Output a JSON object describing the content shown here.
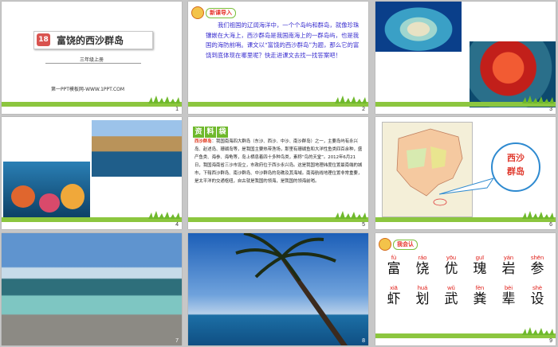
{
  "slide_numbers": [
    "1",
    "2",
    "3",
    "4",
    "5",
    "6",
    "7",
    "8",
    "9"
  ],
  "slide1": {
    "lesson_number": "18",
    "title": "富饶的西沙群岛",
    "grade": "三年级上册",
    "site": "第一PPT模板网-WWW.1PPT.COM"
  },
  "slide2": {
    "header": "新课导入",
    "paragraph": "我们祖国的辽阔海洋中，一个个岛屿和群岛，就像珍珠镶嵌在大海上，西沙群岛是我国南海上的一群岛屿，也是我国的海防前哨。课文以“富饶的西沙群岛”为题，那么它的富饶到底体现在哪里呢？快走进课文去找一找答案吧！"
  },
  "slide5": {
    "header_chars": [
      "资",
      "料",
      "袋"
    ],
    "label": "西沙群岛",
    "body": "我国南海四大群岛（东沙、西沙、中沙、南沙群岛）之一，主要岛屿有永兴岛、赵述岛、珊瑚岛等，是我国主要热带渔场，那里有珊瑚鱼和大洋性鱼类四百余种，盛产鱼类、海参、海龟等，岛上栖息着四十多种鸟类，素称“鸟的天堂”。2012年6月21日，我国海南省三沙市设立，市政府位于西沙永兴岛。这是我国地理纬度位置最南端的城市，下辖西沙群岛、南沙群岛、中沙群岛的岛礁及其海域。南海航线地理位置非常重要，是太平洋的交通枢纽，自古就是我国的领海，是我国的领海前哨。"
  },
  "slide6": {
    "bubble_line1": "西沙",
    "bubble_line2": "群岛"
  },
  "slide9": {
    "header": "我会认",
    "row1": [
      {
        "py": "fù",
        "hz": "富"
      },
      {
        "py": "ráo",
        "hz": "饶"
      },
      {
        "py": "yōu",
        "hz": "优"
      },
      {
        "py": "guī",
        "hz": "瑰"
      },
      {
        "py": "yán",
        "hz": "岩"
      },
      {
        "py": "shēn",
        "hz": "参"
      }
    ],
    "row2": [
      {
        "py": "xiā",
        "hz": "虾"
      },
      {
        "py": "huá",
        "hz": "划"
      },
      {
        "py": "wǔ",
        "hz": "武"
      },
      {
        "py": "fèn",
        "hz": "粪"
      },
      {
        "py": "bèi",
        "hz": "辈"
      },
      {
        "py": "shè",
        "hz": "设"
      }
    ]
  },
  "colors": {
    "accent_green": "#8cc63f",
    "title_red": "#d9534f",
    "blue_text": "#3a2fcf",
    "pinyin_red": "#e0201a"
  }
}
